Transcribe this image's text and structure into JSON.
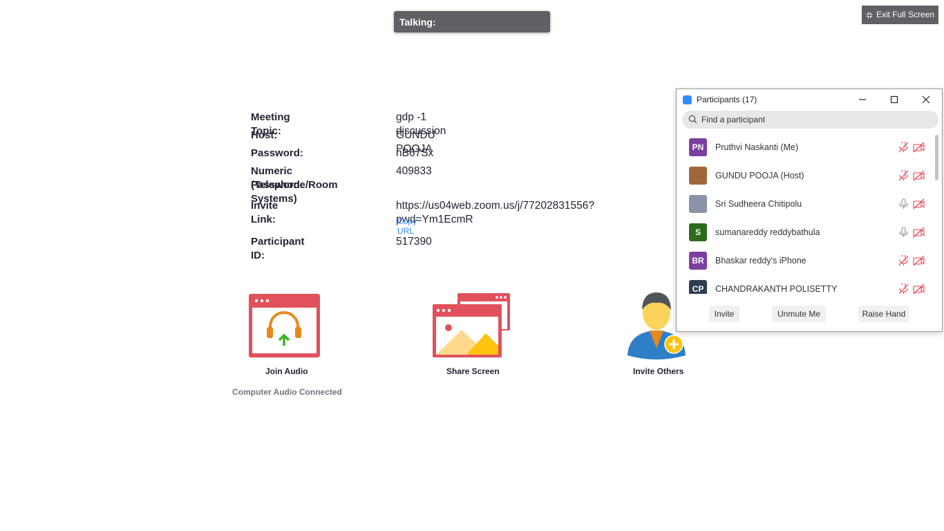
{
  "talking_label": "Talking:",
  "exit_fullscreen_label": "Exit Full Screen",
  "meeting_info": {
    "topic_label": "Meeting Topic:",
    "topic_value": "gdp -1 discussion",
    "host_label": "Host:",
    "host_value": "GUNDU POOJA",
    "password_label": "Password:",
    "password_value": "nB67Sx",
    "numeric_password_label_line1": "Numeric Password:",
    "numeric_password_label_line2": "(Telephone/Room Systems)",
    "numeric_password_value": "409833",
    "invite_link_label": "Invite Link:",
    "invite_link_value": "https://us04web.zoom.us/j/77202831556?pwd=Ym1EcmR",
    "copy_url_label": "Copy URL",
    "participant_id_label": "Participant ID:",
    "participant_id_value": "517390"
  },
  "actions": {
    "join_audio_label": "Join Audio",
    "join_audio_status": "Computer Audio Connected",
    "share_screen_label": "Share Screen",
    "invite_others_label": "Invite Others"
  },
  "participants_panel": {
    "title": "Participants (17)",
    "search_placeholder": "Find a participant",
    "participants": [
      {
        "initials": "PN",
        "name": "Pruthvi Naskanti (Me)",
        "avatar_color": "#7b3fa0",
        "mic": "muted",
        "video": "off"
      },
      {
        "initials": "",
        "name": "GUNDU POOJA (Host)",
        "avatar_color": "#a0673a",
        "mic": "muted",
        "video": "off"
      },
      {
        "initials": "",
        "name": "Sri Sudheera Chitipolu",
        "avatar_color": "#8a93a8",
        "mic": "on",
        "video": "off"
      },
      {
        "initials": "S",
        "name": "sumanareddy reddybathula",
        "avatar_color": "#2e6b1f",
        "mic": "on",
        "video": "off"
      },
      {
        "initials": "BR",
        "name": "Bhaskar reddy's iPhone",
        "avatar_color": "#7b3fa0",
        "mic": "muted",
        "video": "off"
      },
      {
        "initials": "CP",
        "name": "CHANDRAKANTH POLISETTY",
        "avatar_color": "#2c3e50",
        "mic": "muted",
        "video": "off"
      }
    ],
    "invite_button": "Invite",
    "unmute_button": "Unmute Me",
    "raise_hand_button": "Raise Hand"
  }
}
